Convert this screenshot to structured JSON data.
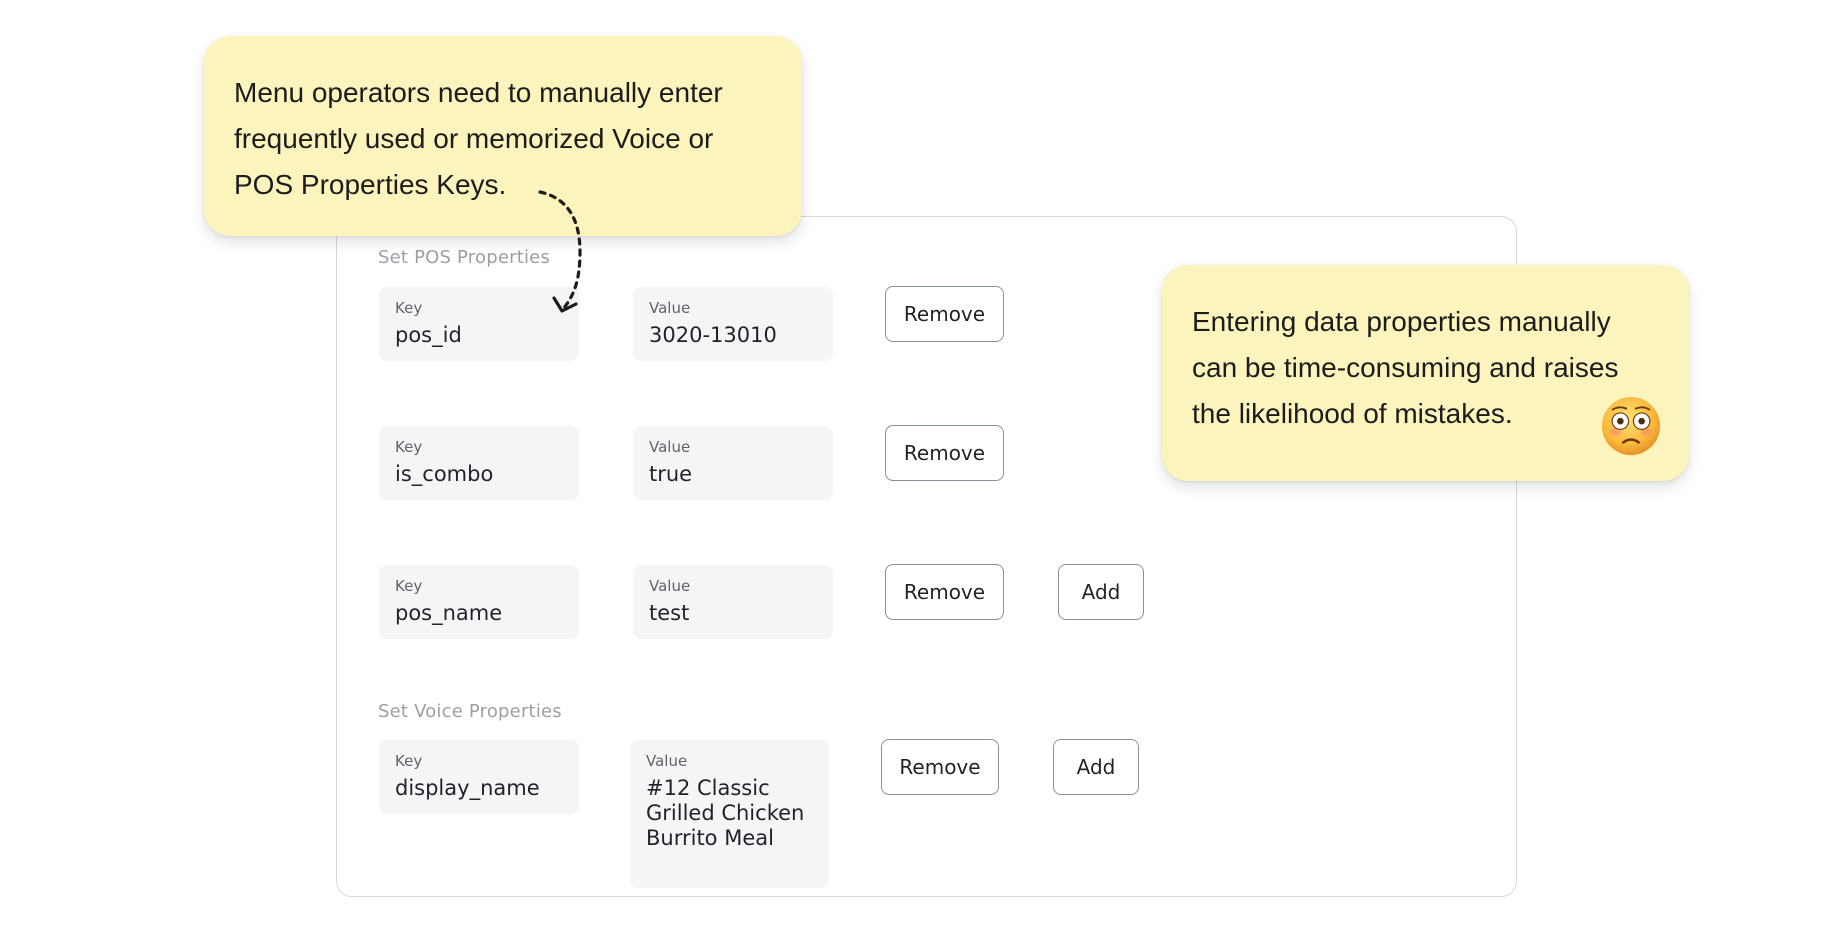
{
  "pos_section": {
    "title": "Set POS Properties",
    "rows": [
      {
        "key_label": "Key",
        "key": "pos_id",
        "value_label": "Value",
        "value": "3020-13010",
        "remove_label": "Remove"
      },
      {
        "key_label": "Key",
        "key": "is_combo",
        "value_label": "Value",
        "value": "true",
        "remove_label": "Remove"
      },
      {
        "key_label": "Key",
        "key": "pos_name",
        "value_label": "Value",
        "value": "test",
        "remove_label": "Remove",
        "add_label": "Add"
      }
    ]
  },
  "voice_section": {
    "title": "Set Voice Properties",
    "rows": [
      {
        "key_label": "Key",
        "key": "display_name",
        "value_label": "Value",
        "value": "#12 Classic\nGrilled Chicken\nBurrito Meal",
        "remove_label": "Remove",
        "add_label": "Add"
      }
    ]
  },
  "annotations": {
    "top": "Menu operators need to manually enter frequently used or memorized Voice or POS Properties Keys.",
    "right": "Entering data properties manually can be time-consuming and raises the likelihood of mistakes."
  },
  "colors": {
    "note_background": "#fbf5bd",
    "field_background": "#f4f5f7",
    "panel_border": "#d6d8dc",
    "button_border": "#8a9099"
  },
  "icons": {
    "arrow": "curved-dashed-arrow-icon",
    "emoji": "flushed-face-emoji-icon"
  }
}
